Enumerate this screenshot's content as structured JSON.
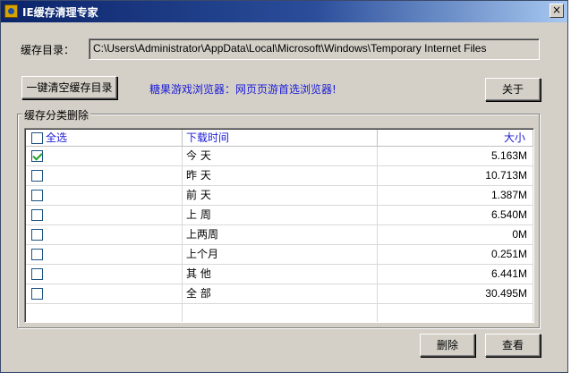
{
  "window": {
    "title": "IE缓存清理专家",
    "close_glyph": "×"
  },
  "cache_dir": {
    "label": "缓存目录：",
    "path": "C:\\Users\\Administrator\\AppData\\Local\\Microsoft\\Windows\\Temporary Internet Files"
  },
  "toolbar": {
    "clear_all_label": "一键清空缓存目录",
    "ad_text": "糖果游戏浏览器：网页页游首选浏览器!",
    "about_label": "关于"
  },
  "group": {
    "title": "缓存分类删除"
  },
  "table": {
    "headers": {
      "select_all": "全选",
      "time": "下载时间",
      "size": "大小"
    },
    "rows": [
      {
        "checked": true,
        "time": "今 天",
        "size": "5.163M"
      },
      {
        "checked": false,
        "time": "昨 天",
        "size": "10.713M"
      },
      {
        "checked": false,
        "time": "前 天",
        "size": "1.387M"
      },
      {
        "checked": false,
        "time": "上 周",
        "size": "6.540M"
      },
      {
        "checked": false,
        "time": "上两周",
        "size": "0M"
      },
      {
        "checked": false,
        "time": "上个月",
        "size": "0.251M"
      },
      {
        "checked": false,
        "time": "其 他",
        "size": "6.441M"
      },
      {
        "checked": false,
        "time": "全 部",
        "size": "30.495M"
      }
    ]
  },
  "actions": {
    "delete_label": "删除",
    "view_label": "查看"
  }
}
